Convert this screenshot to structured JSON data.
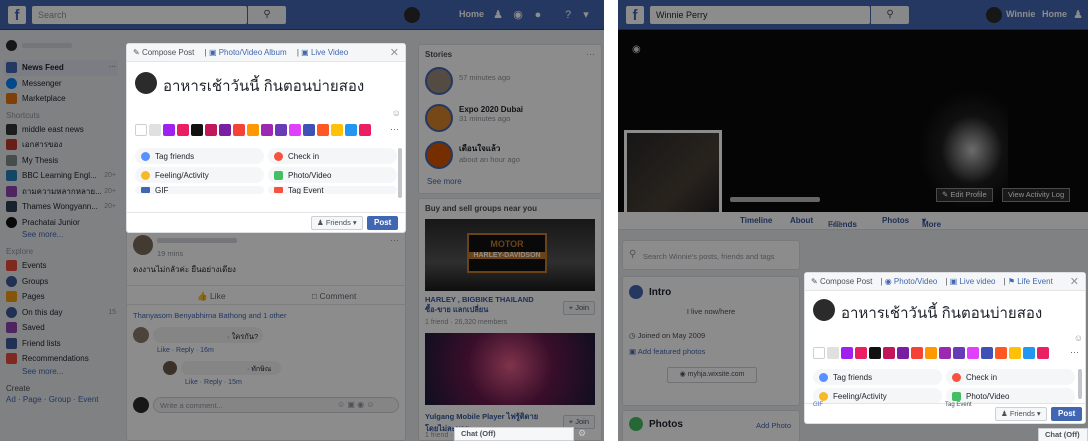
{
  "left": {
    "topbar": {
      "search_placeholder": "Search",
      "search_icon": "search-icon",
      "home": "Home"
    },
    "sidebar": {
      "items": [
        {
          "label": "News Feed",
          "color": "#4267b2"
        },
        {
          "label": "Messenger",
          "color": "#0084ff"
        },
        {
          "label": "Marketplace",
          "color": "#e9710f"
        }
      ],
      "shortcuts_heading": "Shortcuts",
      "shortcuts": [
        {
          "label": "middle east news",
          "color": "#333333"
        },
        {
          "label": "เอกสารของ",
          "color": "#c0392b"
        },
        {
          "label": "My Thesis",
          "color": "#7f8c8d"
        },
        {
          "label": "BBC Learning Engl...",
          "color": "#2980b9",
          "count": "20+"
        },
        {
          "label": "ถามความหลากหลาย...",
          "color": "#8e44ad",
          "count": "20+"
        },
        {
          "label": "Thames Wongyann...",
          "color": "#2c3e50",
          "count": "20+"
        },
        {
          "label": "Prachatai Junior",
          "color": "#111111"
        }
      ],
      "see_more": "See more...",
      "explore_heading": "Explore",
      "explore": [
        {
          "label": "Events",
          "color": "#e74c3c"
        },
        {
          "label": "Groups",
          "color": "#3b5998"
        },
        {
          "label": "Pages",
          "color": "#f39c12"
        },
        {
          "label": "On this day",
          "color": "#3b5998",
          "count": "15"
        },
        {
          "label": "Saved",
          "color": "#8e44ad"
        },
        {
          "label": "Friend lists",
          "color": "#3b5998"
        },
        {
          "label": "Recommendations",
          "color": "#e74c3c"
        }
      ],
      "see_more_2": "See more...",
      "create_heading": "Create",
      "create_links": "Ad · Page · Group · Event"
    },
    "composer": {
      "tab_compose": "Compose Post",
      "tab_album": "Photo/Video Album",
      "tab_live": "Live Video",
      "post_text": "อาหารเช้าวันนี้ กินตอนบ่ายสอง",
      "options": [
        "Tag friends",
        "Check in",
        "Feeling/Activity",
        "Photo/Video",
        "GIF",
        "Tag Event"
      ],
      "friends_btn": "Friends",
      "post_btn": "Post"
    },
    "feed": {
      "post_time": "19 mins",
      "post_text": "ดงงานไม่กลัวค่ะ ยืนอย่างเดียง",
      "like": "Like",
      "comment": "Comment",
      "liked_by": "Thanyasom Benyabhirna Bathong and 1 other",
      "reply_text": "· ใครกัน?",
      "reply_meta": "Like · Reply · 16m",
      "reply2_text": "· ทักษิณ",
      "reply2_meta": "Like · Reply · 15m",
      "comment_placeholder": "Write a comment..."
    },
    "stories": {
      "title": "Stories",
      "items": [
        {
          "name": "",
          "time": "57 minutes ago"
        },
        {
          "name": "Expo 2020 Dubai",
          "time": "31 minutes ago"
        },
        {
          "name": "เดือนใจแล้ว",
          "time": "about an hour ago"
        }
      ],
      "see_more": "See more"
    },
    "groups": {
      "title": "Buy and sell groups near you",
      "g1_name": "HARLEY , BIGBIKE THAILAND ซื้อ-ขาย แลกเปลี่ยน",
      "g1_meta": "1 friend · 26,320 members",
      "g1_logo": "HARLEY-DAVIDSON",
      "g1_motor": "MOTOR",
      "g2_name": "Yulgang Mobile Player ไฟรู้ติดาย โดยไม่ละบาย",
      "g2_meta": "1 friend · 5,127 members",
      "join": "+ Join"
    },
    "chat": "Chat (Off)"
  },
  "right": {
    "topbar": {
      "search_text": "Winnie Perry",
      "user": "Winnie",
      "home": "Home"
    },
    "profile": {
      "edit_profile": "Edit Profile",
      "activity_log": "View Activity Log",
      "tabs": [
        "Timeline",
        "About",
        "Friends",
        "Photos",
        "More"
      ],
      "friends_count": "241",
      "search_placeholder": "Search Winnie's posts, friends and tags",
      "intro": "Intro",
      "lives": "I live now/here",
      "joined": "Joined on May 2009",
      "featured": "Add featured photos",
      "website": "myhja.wixsite.com",
      "photos": "Photos",
      "add_photo": "Add Photo"
    },
    "composer": {
      "tab_compose": "Compose Post",
      "tab_photo": "Photo/Video",
      "tab_live": "Live video",
      "tab_life": "Life Event",
      "post_text": "อาหารเช้าวันนี้ กินตอนบ่ายสอง",
      "options": [
        "Tag friends",
        "Check in",
        "Feeling/Activity",
        "Photo/Video",
        "GIF",
        "Tag Event"
      ],
      "friends_btn": "Friends",
      "post_btn": "Post"
    },
    "chat": "Chat (Off)"
  },
  "swatch_colors": [
    "#ffffff",
    "#e0e0e0",
    "#a020f0",
    "#e91e63",
    "#111111",
    "#c2185b",
    "#7b1fa2",
    "#f44336",
    "#ff9800",
    "#9c27b0",
    "#673ab7",
    "#e040fb",
    "#3f51b5",
    "#ff5722",
    "#ffc107",
    "#2196f3",
    "#e91e63"
  ]
}
